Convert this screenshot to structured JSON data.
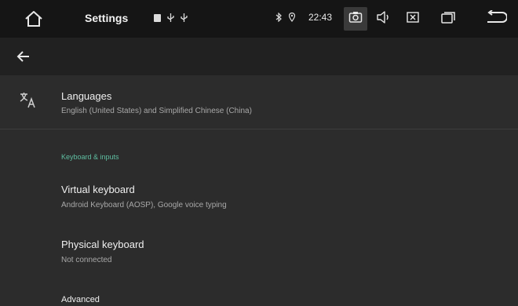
{
  "statusbar": {
    "title": "Settings",
    "time": "22:43",
    "icons_left": [
      "sd-card-icon",
      "usb-icon",
      "usb-icon"
    ],
    "icons_right": [
      "bluetooth-icon",
      "location-icon"
    ],
    "buttons": [
      "home-icon",
      "screenshot-icon",
      "volume-icon",
      "close-box-icon",
      "recents-icon",
      "back-icon"
    ]
  },
  "actionbar": {
    "back_icon": "back-arrow-icon"
  },
  "list": {
    "languages": {
      "title": "Languages",
      "subtitle": "English (United States) and Simplified Chinese (China)",
      "icon": "translate-icon"
    },
    "section_header": "Keyboard & inputs",
    "virtual_keyboard": {
      "title": "Virtual keyboard",
      "subtitle": "Android Keyboard (AOSP), Google voice typing"
    },
    "physical_keyboard": {
      "title": "Physical keyboard",
      "subtitle": "Not connected"
    },
    "advanced": {
      "title": "Advanced"
    }
  },
  "colors": {
    "accent": "#5fbfa2",
    "background": "#2c2c2c",
    "statusbar": "#151515",
    "actionbar": "#212121"
  }
}
